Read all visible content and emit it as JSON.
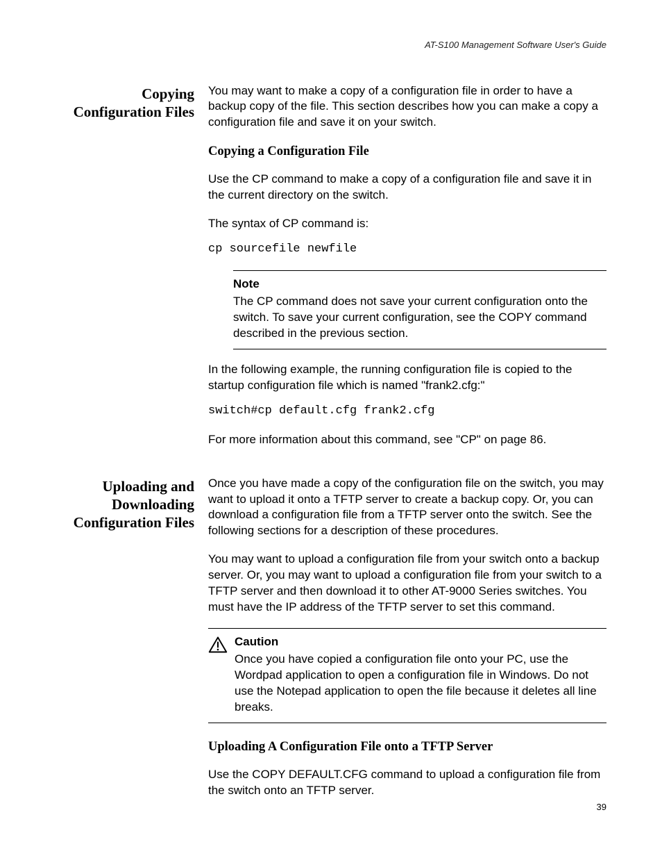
{
  "header": {
    "running": "AT-S100 Management Software User's Guide"
  },
  "footer": {
    "page_number": "39"
  },
  "section1": {
    "side": "Copying Configuration Files",
    "intro": "You may want to make a copy of a configuration file in order to have a backup copy of the file. This section describes how you can make a copy a configuration file and save it on your switch.",
    "sub1": "Copying a Configuration File",
    "p1": "Use the CP command to make a copy of a configuration file and save it in the current directory on the switch.",
    "p2": "The syntax of CP command is:",
    "code1": "cp sourcefile newfile",
    "note_title": "Note",
    "note_body": "The CP command does not save your current configuration onto the switch. To save your current configuration, see the COPY command described in the previous section.",
    "p3": "In the following example, the running configuration file is copied to the startup configuration file which is named \"frank2.cfg:\"",
    "code2": "switch#cp default.cfg frank2.cfg",
    "p4": "For more information about this command, see \"CP\" on page 86."
  },
  "section2": {
    "side": "Uploading and Downloading Configuration Files",
    "intro": "Once you have made a copy of the configuration file on the switch, you may want to upload it onto a TFTP server to create a backup copy. Or, you can download a configuration file from a TFTP server onto the switch. See the following sections for a description of these procedures.",
    "p1": "You may want to upload a configuration file from your switch onto a backup server. Or, you may want to upload a configuration file from your switch to a TFTP server and then download it to other AT-9000 Series switches. You must have the IP address of the TFTP server to set this command.",
    "caution_title": "Caution",
    "caution_body": "Once you have copied a configuration file onto your PC, use the Wordpad application to open a configuration file in Windows. Do not use the Notepad application to open the file because it deletes all line breaks.",
    "sub1": "Uploading A Configuration File onto a TFTP Server",
    "p2": "Use the COPY DEFAULT.CFG command to upload a configuration file from the switch onto an TFTP server."
  }
}
